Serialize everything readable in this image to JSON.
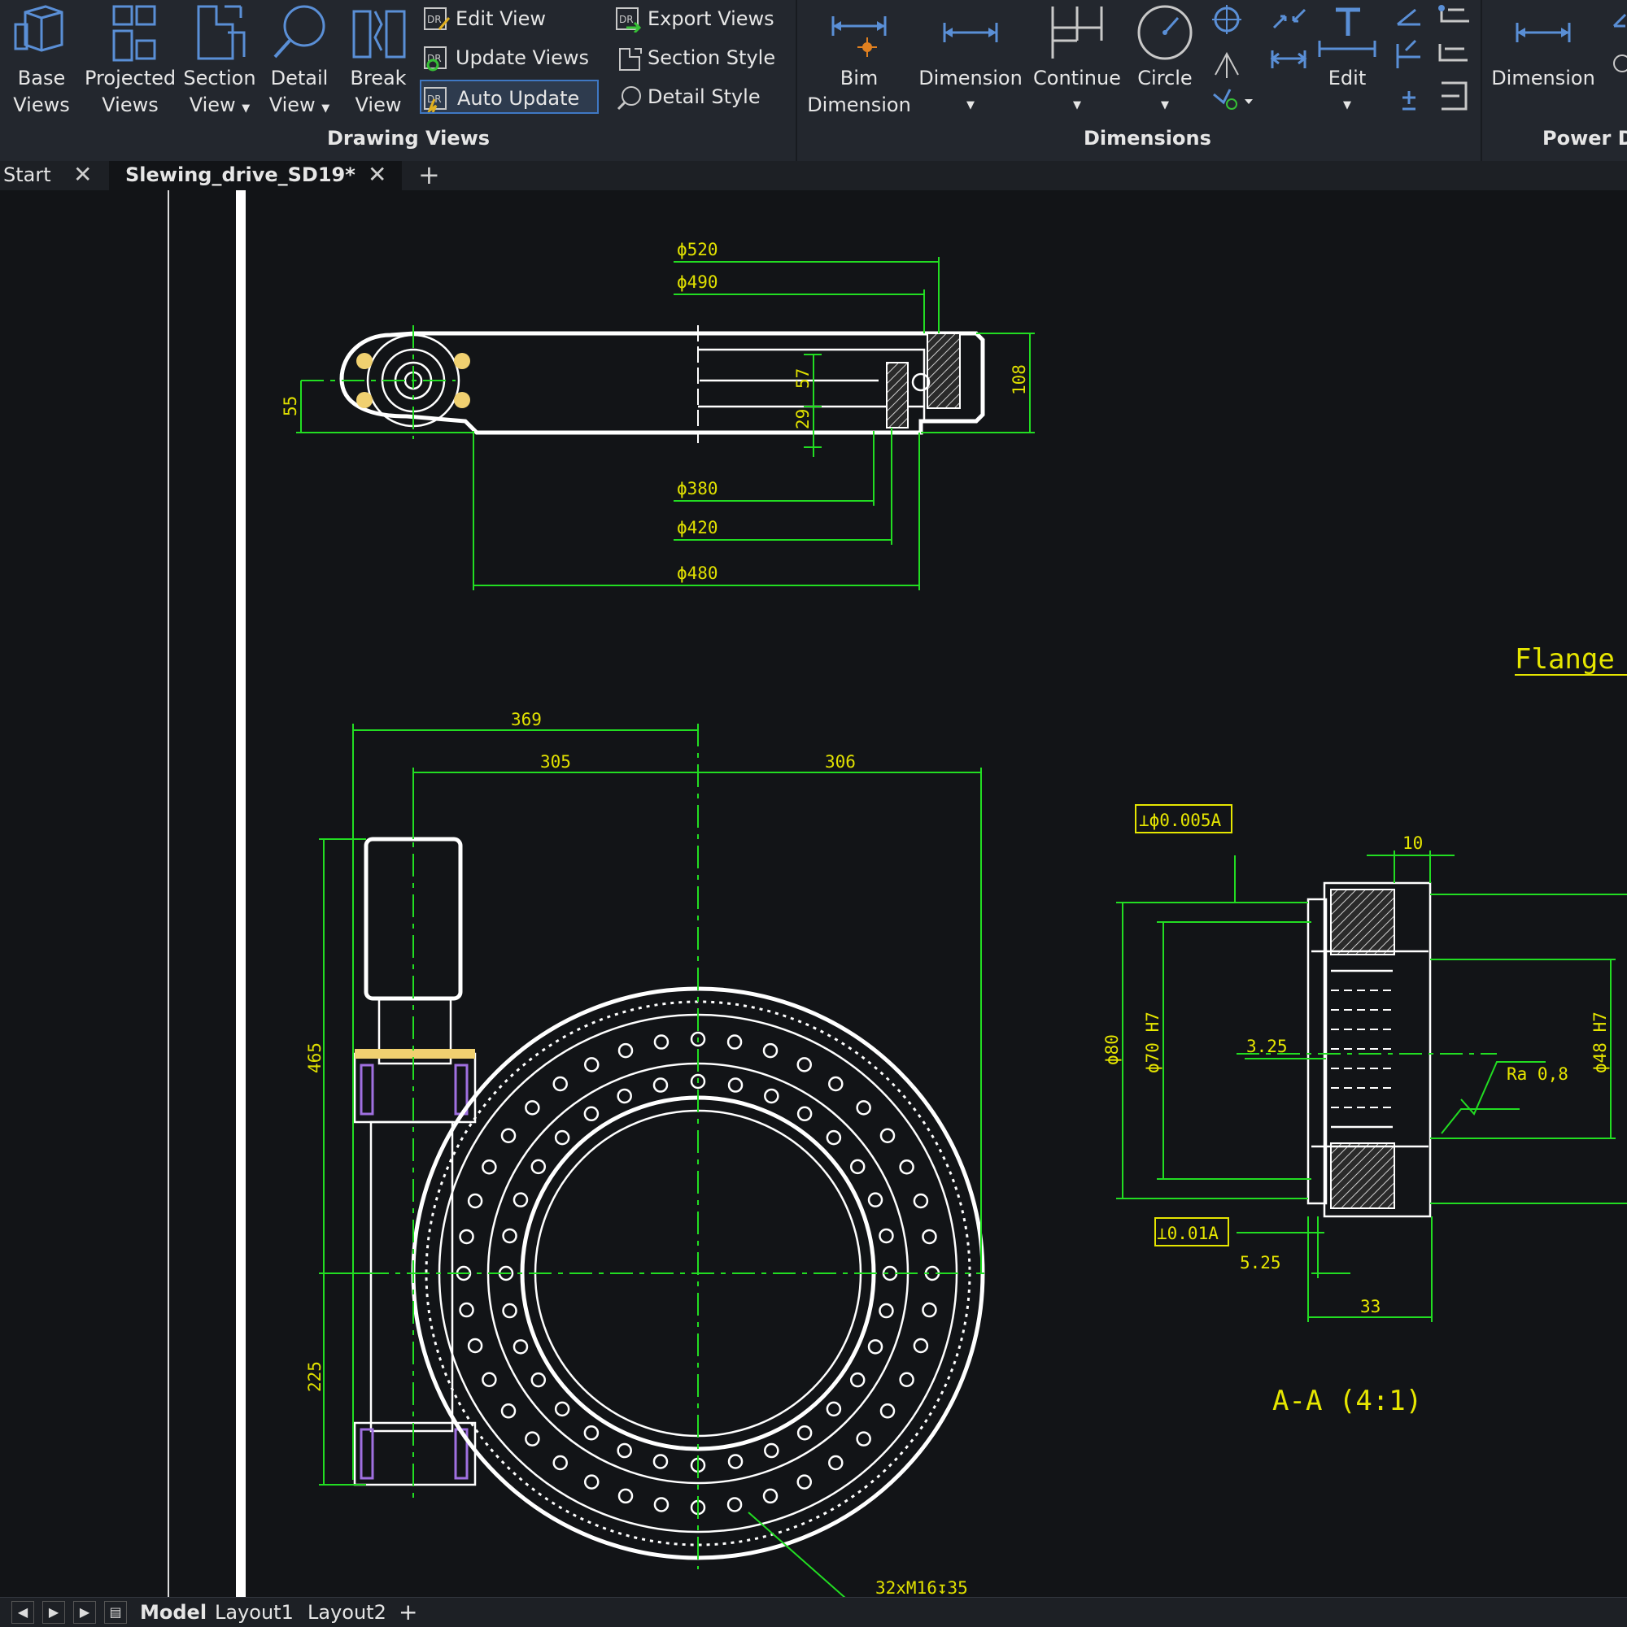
{
  "ribbon": {
    "drawing_views": {
      "group_label": "Drawing Views",
      "base_views": [
        "Base",
        "Views"
      ],
      "projected_views": [
        "Projected",
        "Views"
      ],
      "section_view": [
        "Section",
        "View"
      ],
      "detail_view": [
        "Detail",
        "View"
      ],
      "break_view": [
        "Break",
        "View"
      ],
      "edit_view": "Edit View",
      "update_views": "Update Views",
      "auto_update": "Auto Update",
      "export_views": "Export Views",
      "section_style": "Section Style",
      "detail_style": "Detail Style"
    },
    "dimensions": {
      "group_label": "Dimensions",
      "bim_dimension": [
        "Bim",
        "Dimension"
      ],
      "dimension": "Dimension",
      "continue": "Continue",
      "circle": "Circle",
      "edit": "Edit"
    },
    "power": {
      "group_label": "Power Di",
      "dimension": "Dimension"
    }
  },
  "tabs": {
    "start": "Start",
    "document": "Slewing_drive_SD19*"
  },
  "drawing": {
    "top_view": {
      "d520": "ϕ520",
      "d490": "ϕ490",
      "d380": "ϕ380",
      "d420": "ϕ420",
      "d480": "ϕ480",
      "h57": "57",
      "h29": "29",
      "h108": "108",
      "h55": "55"
    },
    "front_view": {
      "w369": "369",
      "w305": "305",
      "w306": "306",
      "h465": "465",
      "h225": "225",
      "bolt_callout": "32xM16↧35"
    },
    "flange_title": "Flange c",
    "section": {
      "title": "A-A (4:1)",
      "tol_top": "⊥ϕ0.005A",
      "tol_bottom": "⊥0.01A",
      "d80": "ϕ80",
      "d70": "ϕ70 H7",
      "d48": "ϕ48 H7",
      "w10": "10",
      "w325": "3.25",
      "w525": "5.25",
      "w33": "33",
      "ra": "Ra 0,8"
    }
  },
  "status": {
    "model": "Model",
    "layout1": "Layout1",
    "layout2": "Layout2"
  }
}
